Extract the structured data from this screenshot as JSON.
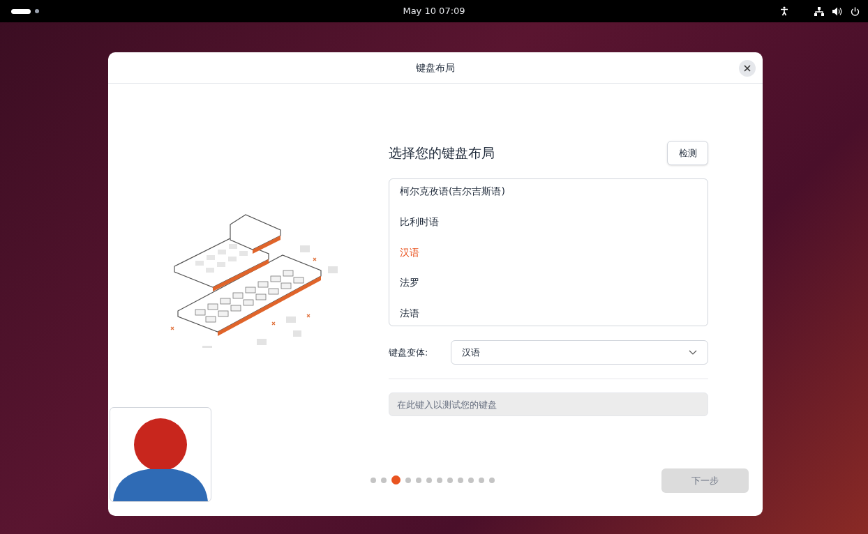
{
  "top_bar": {
    "clock": "May 10  07:09"
  },
  "dialog": {
    "title": "键盘布局",
    "heading": "选择您的键盘布局",
    "detect_button": "检测",
    "layouts": [
      {
        "label": "柯尔克孜语(吉尔吉斯语)",
        "selected": false
      },
      {
        "label": "比利时语",
        "selected": false
      },
      {
        "label": "汉语",
        "selected": true
      },
      {
        "label": "法罗",
        "selected": false
      },
      {
        "label": "法语",
        "selected": false
      }
    ],
    "variant_label": "键盘变体:",
    "variant_value": "汉语",
    "test_field": {
      "placeholder": "在此键入以测试您的键盘"
    },
    "pages": [
      {
        "selected": false
      },
      {
        "selected": false
      },
      {
        "selected": true
      },
      {
        "selected": false
      },
      {
        "selected": false
      },
      {
        "selected": false
      },
      {
        "selected": false
      },
      {
        "selected": false
      },
      {
        "selected": false
      },
      {
        "selected": false
      },
      {
        "selected": false
      },
      {
        "selected": false
      }
    ],
    "next_button": {
      "label": "下一步",
      "disabled": true
    }
  }
}
